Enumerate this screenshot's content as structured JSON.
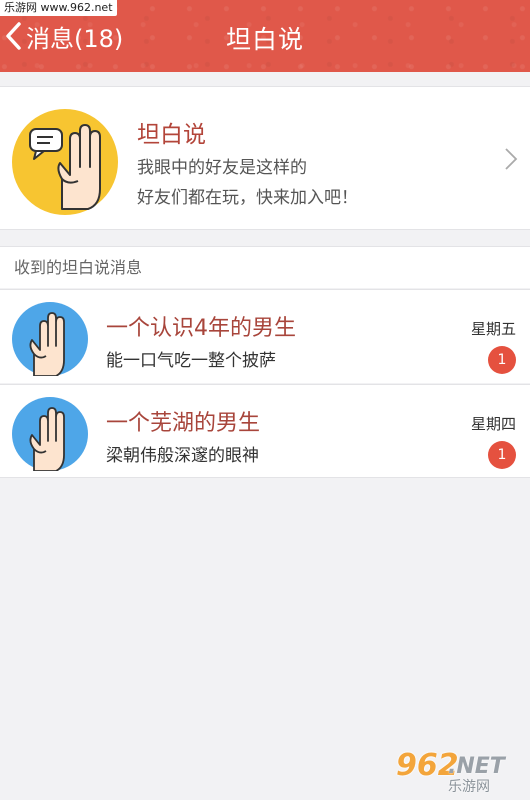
{
  "watermark_top": "乐游网 www.962.net",
  "nav": {
    "back_label": "消息(18)",
    "title": "坦白说"
  },
  "promo": {
    "title": "坦白说",
    "line1": "我眼中的好友是这样的",
    "line2": "好友们都在玩，快来加入吧！",
    "icon": "hand-chat-bubble-icon"
  },
  "section": {
    "header": "收到的坦白说消息"
  },
  "messages": [
    {
      "title": "一个认识4年的男生",
      "subtitle": "能一口气吃一整个披萨",
      "day": "星期五",
      "badge": "1",
      "icon": "male-hand-icon"
    },
    {
      "title": "一个芜湖的男生",
      "subtitle": "梁朝伟般深邃的眼神",
      "day": "星期四",
      "badge": "1",
      "icon": "male-hand-icon"
    }
  ],
  "watermark_br": {
    "num": "962",
    "net": ".NET",
    "cn": "乐游网"
  },
  "colors": {
    "nav_bg": "#e0584a",
    "title_red": "#a8453b",
    "badge_red": "#e5513f",
    "promo_icon_bg": "#f7c531",
    "avatar_bg": "#4ea6e8"
  }
}
